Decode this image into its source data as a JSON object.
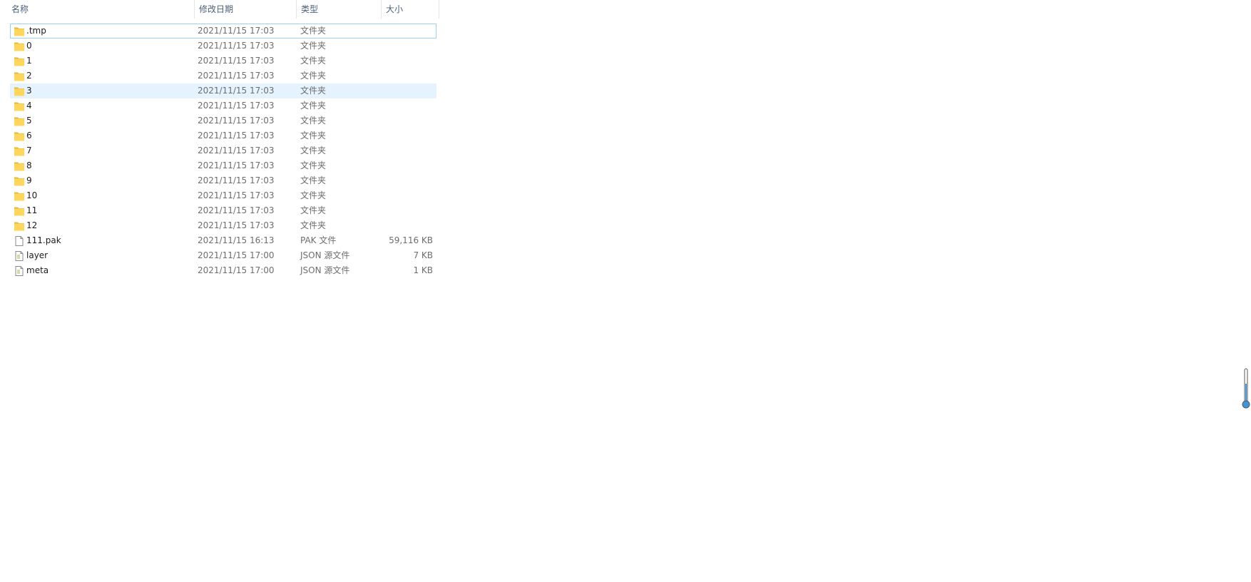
{
  "columns": {
    "name": "名称",
    "date": "修改日期",
    "type": "类型",
    "size": "大小",
    "sort_indicator": "^"
  },
  "rows": [
    {
      "name": ".tmp",
      "date": "2021/11/15 17:03",
      "type": "文件夹",
      "size": "",
      "icon": "folder-icon"
    },
    {
      "name": "0",
      "date": "2021/11/15 17:03",
      "type": "文件夹",
      "size": "",
      "icon": "folder-icon"
    },
    {
      "name": "1",
      "date": "2021/11/15 17:03",
      "type": "文件夹",
      "size": "",
      "icon": "folder-icon"
    },
    {
      "name": "2",
      "date": "2021/11/15 17:03",
      "type": "文件夹",
      "size": "",
      "icon": "folder-icon"
    },
    {
      "name": "3",
      "date": "2021/11/15 17:03",
      "type": "文件夹",
      "size": "",
      "icon": "folder-icon"
    },
    {
      "name": "4",
      "date": "2021/11/15 17:03",
      "type": "文件夹",
      "size": "",
      "icon": "folder-icon"
    },
    {
      "name": "5",
      "date": "2021/11/15 17:03",
      "type": "文件夹",
      "size": "",
      "icon": "folder-icon"
    },
    {
      "name": "6",
      "date": "2021/11/15 17:03",
      "type": "文件夹",
      "size": "",
      "icon": "folder-icon"
    },
    {
      "name": "7",
      "date": "2021/11/15 17:03",
      "type": "文件夹",
      "size": "",
      "icon": "folder-icon"
    },
    {
      "name": "8",
      "date": "2021/11/15 17:03",
      "type": "文件夹",
      "size": "",
      "icon": "folder-icon"
    },
    {
      "name": "9",
      "date": "2021/11/15 17:03",
      "type": "文件夹",
      "size": "",
      "icon": "folder-icon"
    },
    {
      "name": "10",
      "date": "2021/11/15 17:03",
      "type": "文件夹",
      "size": "",
      "icon": "folder-icon"
    },
    {
      "name": "11",
      "date": "2021/11/15 17:03",
      "type": "文件夹",
      "size": "",
      "icon": "folder-icon"
    },
    {
      "name": "12",
      "date": "2021/11/15 17:03",
      "type": "文件夹",
      "size": "",
      "icon": "folder-icon"
    },
    {
      "name": "111.pak",
      "date": "2021/11/15 16:13",
      "type": "PAK 文件",
      "size": "59,116 KB",
      "icon": "file-icon"
    },
    {
      "name": "layer",
      "date": "2021/11/15 17:00",
      "type": "JSON 源文件",
      "size": "7 KB",
      "icon": "json-file-icon"
    },
    {
      "name": "meta",
      "date": "2021/11/15 17:00",
      "type": "JSON 源文件",
      "size": "1 KB",
      "icon": "json-file-icon"
    }
  ],
  "state": {
    "focused_row": ".tmp",
    "hovered_row": "3"
  },
  "colors": {
    "folder": "#ffd65c",
    "folder_dark": "#e8b83a",
    "focus_border": "#99d1ff",
    "hover_bg": "#e5f3ff",
    "header_text": "#4c607a",
    "scroll_accent": "#3a96dd"
  },
  "icons": {
    "scroll_widget": "thermometer-scroll-icon"
  }
}
